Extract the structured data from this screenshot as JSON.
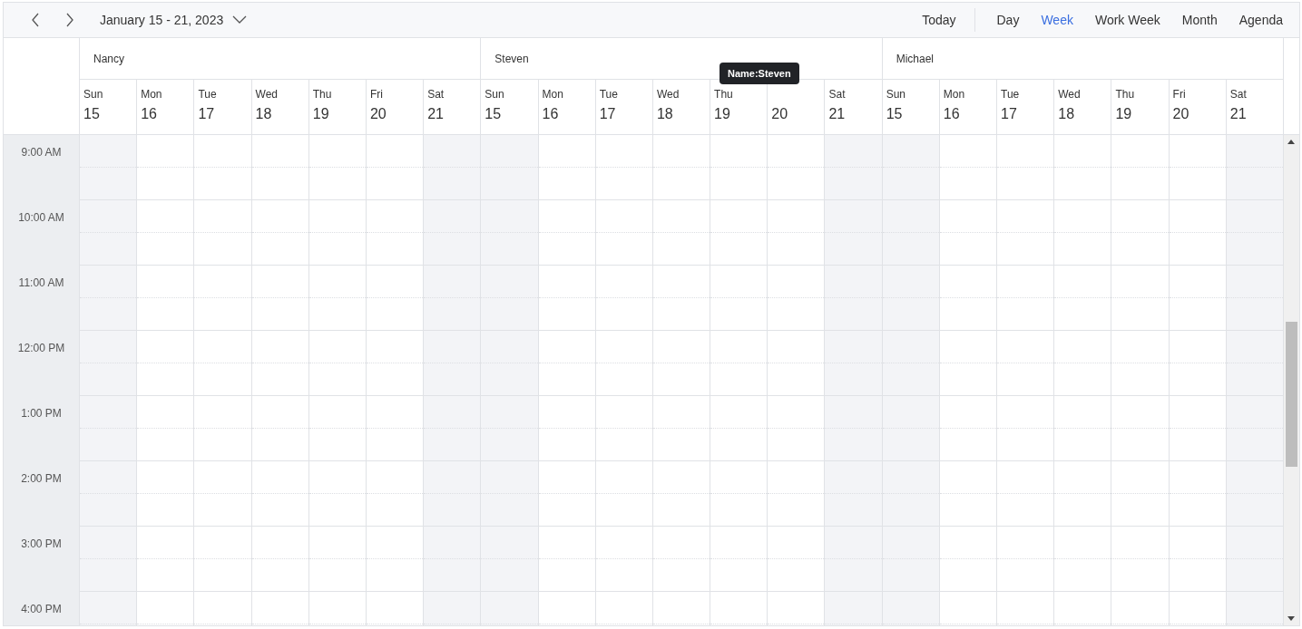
{
  "toolbar": {
    "date_range": "January 15 - 21, 2023",
    "today": "Today",
    "views": [
      {
        "label": "Day",
        "selected": false
      },
      {
        "label": "Week",
        "selected": true
      },
      {
        "label": "Work Week",
        "selected": false
      },
      {
        "label": "Month",
        "selected": false
      },
      {
        "label": "Agenda",
        "selected": false
      }
    ]
  },
  "resources": [
    {
      "name": "Nancy",
      "days": [
        {
          "day": "Sun",
          "date": "15",
          "kind": "weekend"
        },
        {
          "day": "Mon",
          "date": "16",
          "kind": "weekday"
        },
        {
          "day": "Tue",
          "date": "17",
          "kind": "weekday"
        },
        {
          "day": "Wed",
          "date": "18",
          "kind": "weekday"
        },
        {
          "day": "Thu",
          "date": "19",
          "kind": "weekday"
        },
        {
          "day": "Fri",
          "date": "20",
          "kind": "weekday"
        },
        {
          "day": "Sat",
          "date": "21",
          "kind": "weekend"
        }
      ]
    },
    {
      "name": "Steven",
      "days": [
        {
          "day": "Sun",
          "date": "15",
          "kind": "weekend"
        },
        {
          "day": "Mon",
          "date": "16",
          "kind": "weekday"
        },
        {
          "day": "Tue",
          "date": "17",
          "kind": "weekday"
        },
        {
          "day": "Wed",
          "date": "18",
          "kind": "weekday"
        },
        {
          "day": "Thu",
          "date": "19",
          "kind": "weekday"
        },
        {
          "date": "20",
          "kind": "weekday"
        },
        {
          "day": "Sat",
          "date": "21",
          "kind": "weekend"
        }
      ]
    },
    {
      "name": "Michael",
      "days": [
        {
          "day": "Sun",
          "date": "15",
          "kind": "weekend"
        },
        {
          "day": "Mon",
          "date": "16",
          "kind": "weekday"
        },
        {
          "day": "Tue",
          "date": "17",
          "kind": "weekday"
        },
        {
          "day": "Wed",
          "date": "18",
          "kind": "weekday"
        },
        {
          "day": "Thu",
          "date": "19",
          "kind": "weekday"
        },
        {
          "day": "Fri",
          "date": "20",
          "kind": "weekday"
        },
        {
          "day": "Sat",
          "date": "21",
          "kind": "weekend"
        }
      ]
    }
  ],
  "times": [
    "9:00 AM",
    "10:00 AM",
    "11:00 AM",
    "12:00 PM",
    "1:00 PM",
    "2:00 PM",
    "3:00 PM",
    "4:00 PM"
  ],
  "tooltip": "Name:Steven"
}
